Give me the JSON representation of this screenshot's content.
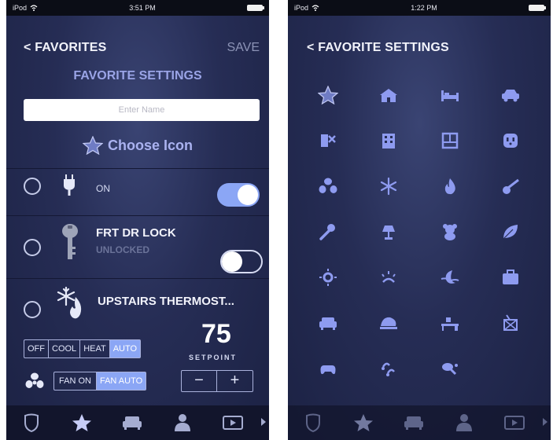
{
  "left_screen": {
    "status": {
      "carrier": "iPod",
      "time": "3:51 PM"
    },
    "nav": {
      "back_label": "< FAVORITES",
      "save_label": "SAVE"
    },
    "title": "FAVORITE SETTINGS",
    "name_input": {
      "placeholder": "Enter Name",
      "value": ""
    },
    "choose_icon_label": "Choose Icon",
    "devices": [
      {
        "icon": "plug-icon",
        "title": "",
        "status": "ON",
        "toggle_on": true
      },
      {
        "icon": "key-icon",
        "title": "FRT DR LOCK",
        "status": "UNLOCKED",
        "toggle_on": false
      },
      {
        "icon": "thermostat-icon",
        "title": "UPSTAIRS THERMOST...",
        "modes": [
          "OFF",
          "COOL",
          "HEAT",
          "AUTO"
        ],
        "selected_mode": "AUTO",
        "fan_modes": [
          "FAN ON",
          "FAN AUTO"
        ],
        "selected_fan_mode": "FAN AUTO",
        "setpoint": "75",
        "setpoint_label": "SETPOINT",
        "stepper": {
          "minus": "−",
          "plus": "+"
        }
      }
    ],
    "tabbar": [
      "shield-icon",
      "star-icon",
      "sofa-icon",
      "person-icon",
      "play-icon"
    ]
  },
  "right_screen": {
    "status": {
      "carrier": "iPod",
      "time": "1:22 PM"
    },
    "nav": {
      "back_label": "< FAVORITE SETTINGS"
    },
    "icons": [
      "star-icon",
      "house-icon",
      "bed-icon",
      "car-icon",
      "pets-icon",
      "building-icon",
      "window-icon",
      "outlet-icon",
      "fan-icon",
      "snowflake-icon",
      "flame-icon",
      "guitar-icon",
      "microphone-icon",
      "lamp-icon",
      "teddy-bear-icon",
      "leaf-icon",
      "sun-icon",
      "sunrise-icon",
      "moon-icon",
      "suitcase-icon",
      "sofa-icon",
      "lamp-shade-icon",
      "desk-icon",
      "drum-icon",
      "gamepad-icon",
      "music-notes-icon",
      "ping-pong-icon"
    ],
    "tabbar": [
      "shield-icon",
      "star-icon",
      "sofa-icon",
      "person-icon",
      "play-icon"
    ]
  },
  "colors": {
    "accent": "#8ba6f5",
    "title": "#9aa4e6",
    "background": "#262d55",
    "tabbar": "#12152c"
  }
}
